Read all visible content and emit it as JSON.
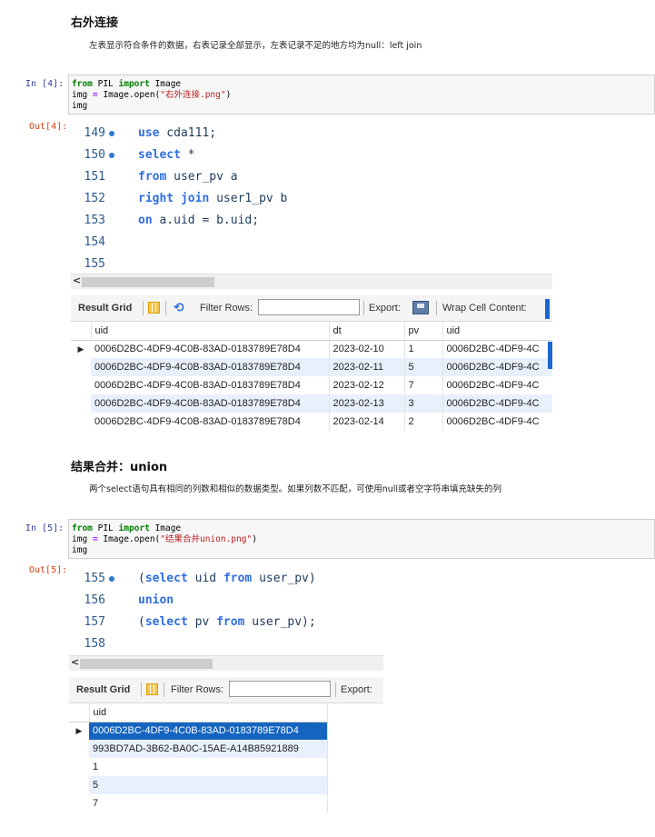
{
  "section1": {
    "heading": "右外连接",
    "desc": "左表显示符合条件的数据，右表记录全部显示，左表记录不足的地方均为null：left join"
  },
  "cell4": {
    "in_prompt": "In  [4]:",
    "out_prompt": "Out[4]:",
    "code": {
      "line1": {
        "kw1": "from",
        "mod": " PIL ",
        "kw2": "import",
        "name": " Image"
      },
      "line2": {
        "pre": "img ",
        "op": "=",
        "mid": " Image.open(",
        "str": "\"右外连接.png\"",
        "post": ")"
      },
      "line3": "img"
    },
    "editor": {
      "lines": [
        {
          "num": "149",
          "dot": true,
          "parts": [
            {
              "k": "use"
            },
            {
              "t": " cda111;"
            }
          ]
        },
        {
          "num": "150",
          "dot": true,
          "parts": [
            {
              "k": "select"
            },
            {
              "t": " *"
            }
          ]
        },
        {
          "num": "151",
          "dot": false,
          "parts": [
            {
              "k": "from"
            },
            {
              "t": " user_pv a"
            }
          ]
        },
        {
          "num": "152",
          "dot": false,
          "parts": [
            {
              "k": "right join"
            },
            {
              "t": " user1_pv b"
            }
          ]
        },
        {
          "num": "153",
          "dot": false,
          "parts": [
            {
              "k": "on"
            },
            {
              "t": " a.uid = b.uid;"
            }
          ]
        },
        {
          "num": "154",
          "dot": false,
          "parts": []
        },
        {
          "num": "155",
          "dot": false,
          "parts": []
        }
      ]
    },
    "scroll_arrow": "<",
    "toolbar": {
      "result_grid": "Result Grid",
      "filter_rows": "Filter Rows:",
      "export": "Export:",
      "wrap": "Wrap Cell Content:"
    },
    "table": {
      "headers": [
        "uid",
        "dt",
        "pv",
        "uid"
      ],
      "rows": [
        [
          "0006D2BC-4DF9-4C0B-83AD-0183789E78D4",
          "2023-02-10",
          "1",
          "0006D2BC-4DF9-4C"
        ],
        [
          "0006D2BC-4DF9-4C0B-83AD-0183789E78D4",
          "2023-02-11",
          "5",
          "0006D2BC-4DF9-4C"
        ],
        [
          "0006D2BC-4DF9-4C0B-83AD-0183789E78D4",
          "2023-02-12",
          "7",
          "0006D2BC-4DF9-4C"
        ],
        [
          "0006D2BC-4DF9-4C0B-83AD-0183789E78D4",
          "2023-02-13",
          "3",
          "0006D2BC-4DF9-4C"
        ],
        [
          "0006D2BC-4DF9-4C0B-83AD-0183789E78D4",
          "2023-02-14",
          "2",
          "0006D2BC-4DF9-4C"
        ]
      ]
    }
  },
  "section2": {
    "heading": "结果合并：union",
    "desc": "两个select语句具有相同的列数和相似的数据类型。如果列数不匹配，可使用null或者空字符串填充缺失的列"
  },
  "cell5": {
    "in_prompt": "In  [5]:",
    "out_prompt": "Out[5]:",
    "code": {
      "line1": {
        "kw1": "from",
        "mod": " PIL ",
        "kw2": "import",
        "name": " Image"
      },
      "line2": {
        "pre": "img ",
        "op": "=",
        "mid": " Image.open(",
        "str": "\"结果合并union.png\"",
        "post": ")"
      },
      "line3": "img"
    },
    "editor": {
      "lines": [
        {
          "num": "155",
          "dot": true,
          "parts": [
            {
              "t": "("
            },
            {
              "k": "select"
            },
            {
              "t": " uid "
            },
            {
              "k": "from"
            },
            {
              "t": " user_pv)"
            }
          ]
        },
        {
          "num": "156",
          "dot": false,
          "parts": [
            {
              "k": "union"
            }
          ]
        },
        {
          "num": "157",
          "dot": false,
          "parts": [
            {
              "t": "("
            },
            {
              "k": "select"
            },
            {
              "t": " pv "
            },
            {
              "k": "from"
            },
            {
              "t": " user_pv);"
            }
          ]
        },
        {
          "num": "158",
          "dot": false,
          "parts": []
        }
      ]
    },
    "scroll_arrow": "<",
    "toolbar": {
      "result_grid": "Result Grid",
      "filter_rows": "Filter Rows:",
      "export": "Export:"
    },
    "table": {
      "headers": [
        "uid"
      ],
      "rows": [
        [
          "0006D2BC-4DF9-4C0B-83AD-0183789E78D4"
        ],
        [
          "993BD7AD-3B62-BA0C-15AE-A14B85921889"
        ],
        [
          "1"
        ],
        [
          "5"
        ],
        [
          "7"
        ]
      ]
    }
  },
  "row_marker": "▶"
}
